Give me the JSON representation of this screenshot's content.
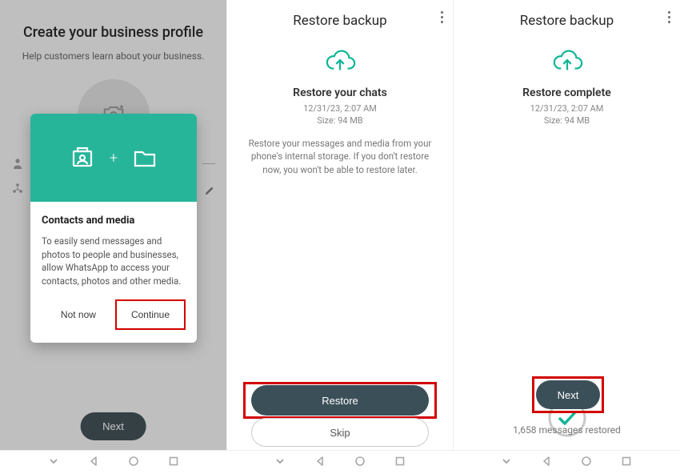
{
  "panel1": {
    "bg_title": "Create your business profile",
    "bg_sub": "Help customers learn about your business.",
    "next_label": "Next",
    "dialog": {
      "title": "Contacts and media",
      "body": "To easily send messages and photos to people and businesses, allow WhatsApp to access your contacts, photos and other media.",
      "not_now": "Not now",
      "continue": "Continue"
    }
  },
  "panel2": {
    "appbar": "Restore backup",
    "heading": "Restore your chats",
    "meta_date": "12/31/23, 2:07 AM",
    "meta_size": "Size: 94 MB",
    "desc": "Restore your messages and media from your phone's internal storage. If you don't restore now, you won't be able to restore later.",
    "restore": "Restore",
    "skip": "Skip"
  },
  "panel3": {
    "appbar": "Restore backup",
    "heading": "Restore complete",
    "meta_date": "12/31/23, 2:07 AM",
    "meta_size": "Size: 94 MB",
    "next": "Next",
    "restored": "1,658 messages restored"
  }
}
